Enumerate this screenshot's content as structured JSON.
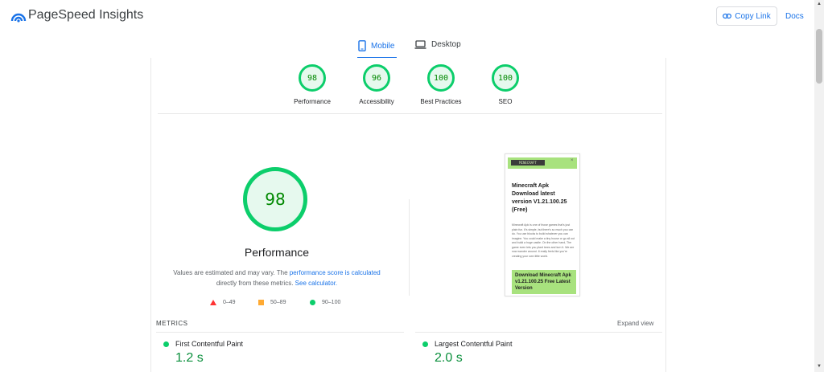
{
  "app": {
    "title": "PageSpeed Insights",
    "copy_link_label": "Copy Link",
    "docs_label": "Docs"
  },
  "device_tabs": [
    {
      "label": "Mobile",
      "icon": "smartphone-icon",
      "active": true
    },
    {
      "label": "Desktop",
      "icon": "laptop-icon",
      "active": false
    }
  ],
  "category_scores": [
    {
      "label": "Performance",
      "score": "98"
    },
    {
      "label": "Accessibility",
      "score": "96"
    },
    {
      "label": "Best Practices",
      "score": "100"
    },
    {
      "label": "SEO",
      "score": "100"
    }
  ],
  "performance": {
    "score": "98",
    "title": "Performance",
    "note_prefix": "Values are estimated and may vary. The ",
    "note_link1": "performance score is calculated",
    "note_mid": " directly from these metrics. ",
    "note_link2": "See calculator."
  },
  "legend": [
    {
      "range": "0–49",
      "shape": "triangle",
      "color": "#ff3333"
    },
    {
      "range": "50–89",
      "shape": "square",
      "color": "#ffaa33"
    },
    {
      "range": "90–100",
      "shape": "circle",
      "color": "#0cce6b"
    }
  ],
  "screenshot_preview": {
    "logo_text": "MINECRAFT",
    "close": "×",
    "title": "Minecraft Apk Download latest version V1.21.100.25 (Free)",
    "body": "Minecraft Apk is one of those games that's just plain fun. It's simple, but there's so much you can do. You use blocks to build whatever you can imagine. You could make a tiny house or go all out and build a huge castle. On the other hand, The game even lets you plant trees and turn it. We are now wander around. It really feels like you're creating your own little world.",
    "cta": "Download Minecraft Apk v1.21.100.25 Free Latest Version"
  },
  "metrics": {
    "label": "METRICS",
    "expand_label": "Expand view",
    "items": [
      {
        "name": "First Contentful Paint",
        "value": "1.2 s"
      },
      {
        "name": "Largest Contentful Paint",
        "value": "2.0 s"
      }
    ]
  },
  "colors": {
    "accent": "#1a73e8",
    "pass": "#0cce6b",
    "pass_text": "#008800"
  }
}
